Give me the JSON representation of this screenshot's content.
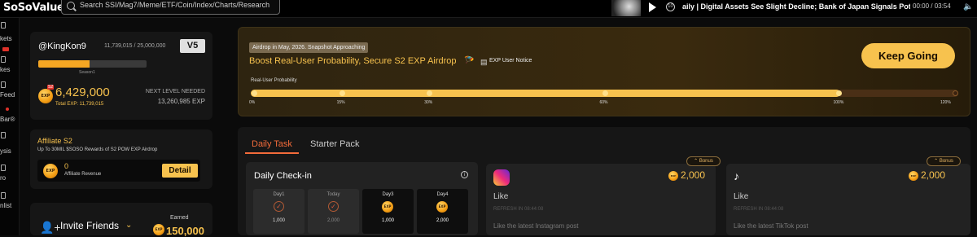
{
  "header": {
    "logo": "SoSoValue",
    "search_placeholder": "Search SSI/Mag7/Meme/ETF/Coin/Index/Charts/Research",
    "news_title": "aily | Digital Assets See Slight Decline; Bank of Japan Signals Potential",
    "time": "00:00 / 03:54",
    "rewind_label": "10",
    "icons": {
      "search": "search-icon",
      "play": "play-icon",
      "rewind": "rewind-icon",
      "volume": "volume-icon"
    }
  },
  "nav": {
    "items": [
      "kets",
      "kes",
      "Feed",
      "Bar®",
      "ysis",
      "ro",
      "nlist"
    ],
    "red_tag_after": "kets",
    "red_dot_on": "Bar®"
  },
  "user": {
    "name": "@KingKon9",
    "exp_progress": "11,739,015 / 25,000,000",
    "level": "V5",
    "progress_fraction": 0.47,
    "season": "Season1",
    "points": "6,429,000",
    "total_exp": "Total EXP: 11,739,015",
    "next_level_label": "NEXT LEVEL NEEDED",
    "next_level_exp": "13,260,985 EXP",
    "coin_text": "EXP",
    "coin_tag": "S2"
  },
  "affiliate": {
    "title": "Affiliate S2",
    "desc": "Up To 30MIL $SOSO Rewards of S2 POW EXP Airdrop",
    "value": "0",
    "revenue_label": "Affiliate Revenue",
    "detail_btn": "Detail"
  },
  "invite": {
    "title": "Invite Friends",
    "earned_label": "Earned",
    "earned_value": "150,000"
  },
  "banner": {
    "badge": "Airdrop in May, 2026. Snapshot Approaching",
    "headline": "Boost Real-User Probability, Secure S2 EXP Airdrop",
    "exp_notice": "EXP User Notice",
    "cta": "Keep Going",
    "prob_label": "Real-User Probability",
    "progress_percent": 100,
    "max_percent": 120,
    "ticks": [
      "0%",
      "15%",
      "30%",
      "60%",
      "100%",
      "120%"
    ],
    "tick_values": [
      0,
      15,
      30,
      60,
      100,
      120
    ]
  },
  "tasks": {
    "tab_daily": "Daily Task",
    "tab_starter": "Starter Pack",
    "checkin_title": "Daily Check-in",
    "days": [
      {
        "label": "Day1",
        "value": "1,000",
        "state": "done"
      },
      {
        "label": "Today",
        "value": "2,000",
        "state": "done"
      },
      {
        "label": "Day3",
        "value": "1,000",
        "state": "upcoming"
      },
      {
        "label": "Day4",
        "value": "2,000",
        "state": "upcoming"
      }
    ],
    "cards": [
      {
        "icon": "instagram-icon",
        "bonus": "Bonus",
        "points": "2,000",
        "title": "Like",
        "refresh": "REFRESH IN 08:44:08",
        "desc": "Like the latest Instagram post"
      },
      {
        "icon": "tiktok-icon",
        "bonus": "Bonus",
        "points": "2,000",
        "title": "Like",
        "refresh": "REFRESH IN 08:44:08",
        "desc": "Like the latest TikTok post"
      }
    ]
  },
  "colors": {
    "accent": "#f7c24e",
    "tab_active": "#f26b3a",
    "bg": "#0b0b0b",
    "card": "#161616"
  }
}
